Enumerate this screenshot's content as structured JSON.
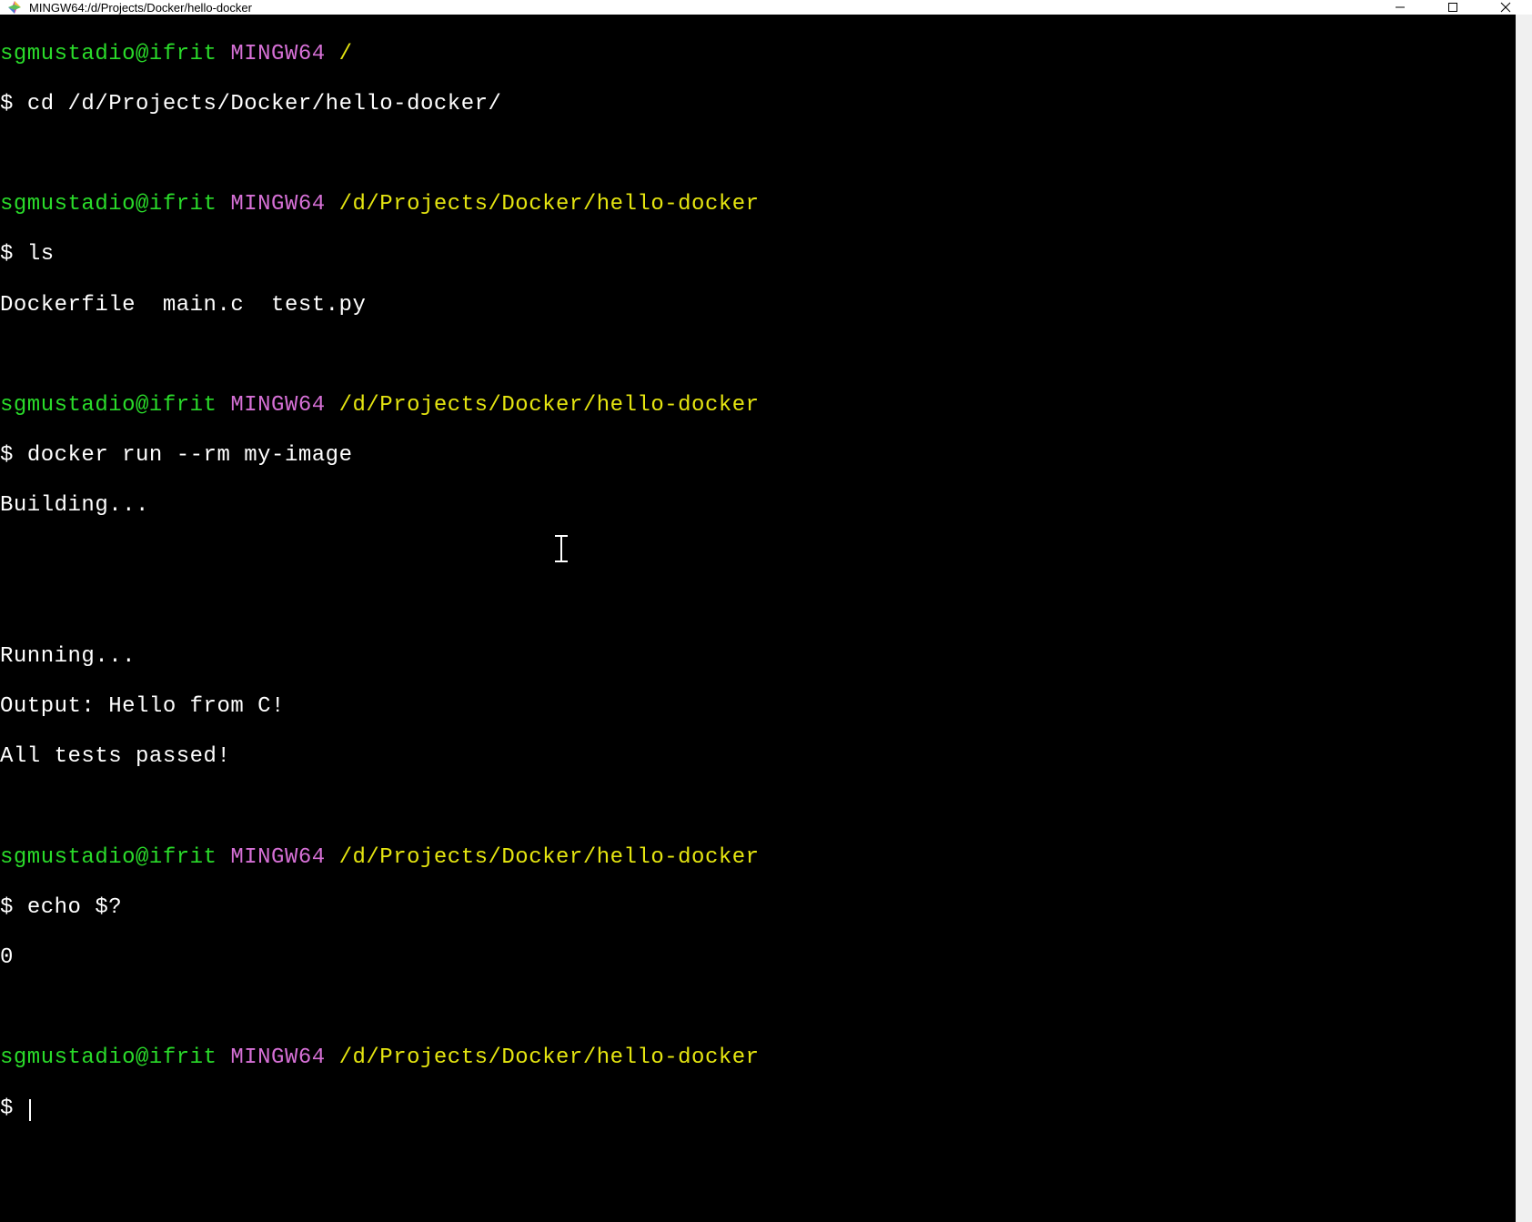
{
  "window": {
    "title": "MINGW64:/d/Projects/Docker/hello-docker"
  },
  "colors": {
    "user": "#2adb2a",
    "sys": "#d670d6",
    "path": "#e5e510",
    "fg": "#ffffff",
    "bg": "#000000"
  },
  "prompt": {
    "user_host": "sgmustadio@ifrit",
    "sys": "MINGW64",
    "path_root": "/",
    "path_project": "/d/Projects/Docker/hello-docker",
    "symbol": "$"
  },
  "session": [
    {
      "path": "/",
      "command": "cd /d/Projects/Docker/hello-docker/",
      "output": []
    },
    {
      "path": "/d/Projects/Docker/hello-docker",
      "command": "ls",
      "output": [
        "Dockerfile  main.c  test.py"
      ]
    },
    {
      "path": "/d/Projects/Docker/hello-docker",
      "command": "docker run --rm my-image",
      "output": [
        "Building...",
        "",
        "",
        "Running...",
        "Output: Hello from C!",
        "All tests passed!"
      ]
    },
    {
      "path": "/d/Projects/Docker/hello-docker",
      "command": "echo $?",
      "output": [
        "0"
      ]
    },
    {
      "path": "/d/Projects/Docker/hello-docker",
      "command": "",
      "output": []
    }
  ]
}
